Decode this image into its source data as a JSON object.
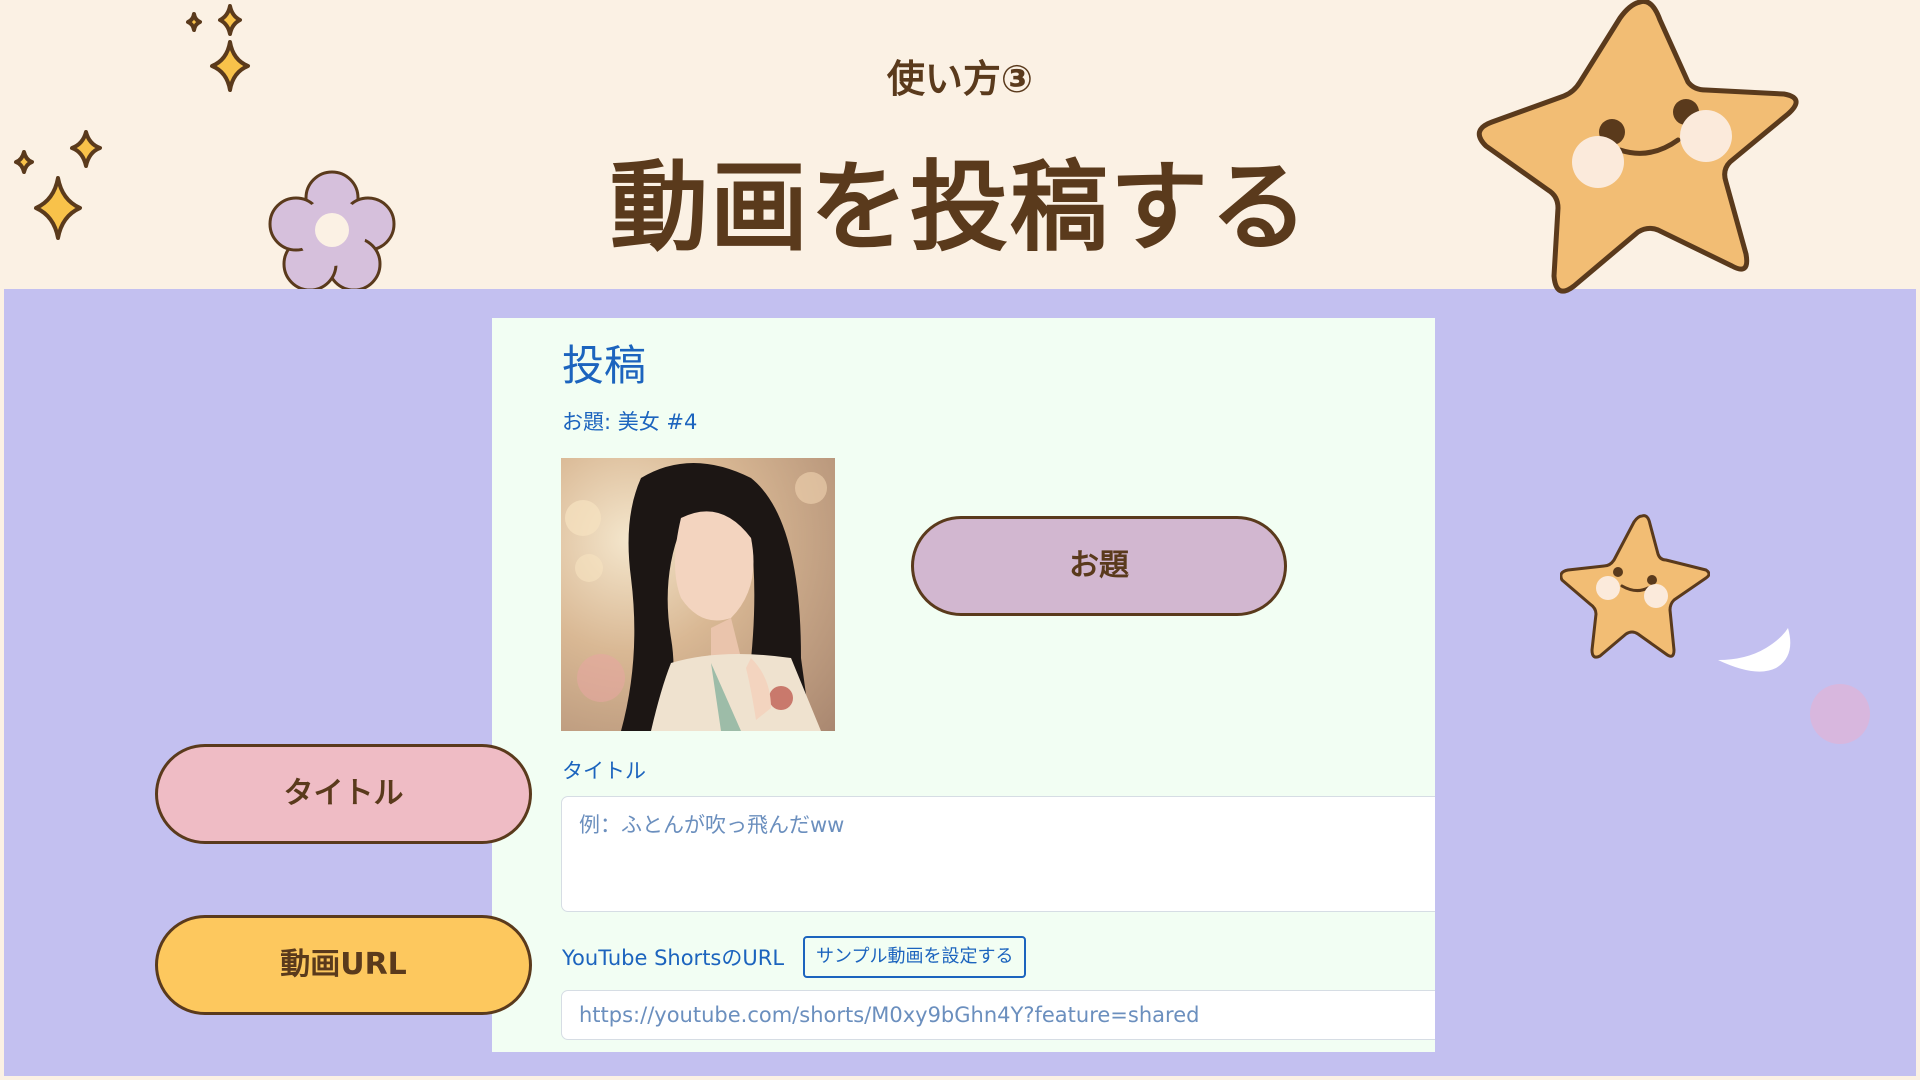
{
  "slide": {
    "subtitle": "使い方③",
    "title": "動画を投稿する"
  },
  "panel": {
    "heading": "投稿",
    "theme_line": "お題: 美女 #4",
    "image_alt": "お題",
    "title_label": "タイトル",
    "title_placeholder": "例：ふとんが吹っ飛んだww",
    "url_label": "YouTube ShortsのURL",
    "sample_button_label": "サンプル動画を設定する",
    "url_value": "https://youtube.com/shorts/M0xy9bGhn4Y?feature=shared"
  },
  "callouts": {
    "theme": "お題",
    "title": "タイトル",
    "url": "動画URL"
  },
  "colors": {
    "background": "#fbf1e4",
    "band": "#c3c0f0",
    "panel": "#f2fef3",
    "text_brown": "#5a3a1c",
    "link_blue": "#1c64be",
    "pill_theme": "#d2b7d0",
    "pill_title": "#efbcc5",
    "pill_url": "#fdc85e",
    "star": "#f2bd74"
  },
  "icons": [
    "sparkle-icon",
    "flower-icon",
    "star-face-icon",
    "moon-icon",
    "circle-icon"
  ]
}
